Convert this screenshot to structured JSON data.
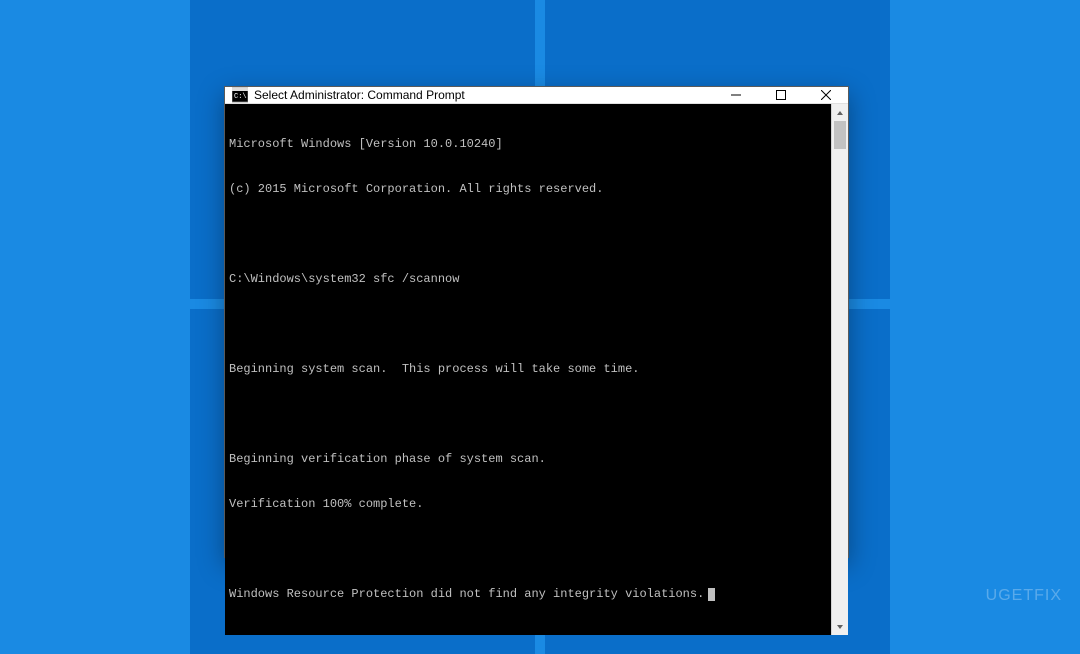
{
  "window": {
    "title": "Select Administrator: Command Prompt"
  },
  "console": {
    "lines": [
      "Microsoft Windows [Version 10.0.10240]",
      "(c) 2015 Microsoft Corporation. All rights reserved.",
      "",
      "C:\\Windows\\system32 sfc /scannow",
      "",
      "Beginning system scan.  This process will take some time.",
      "",
      "Beginning verification phase of system scan.",
      "Verification 100% complete.",
      "",
      "Windows Resource Protection did not find any integrity violations."
    ]
  },
  "watermark": "UGETFIX"
}
